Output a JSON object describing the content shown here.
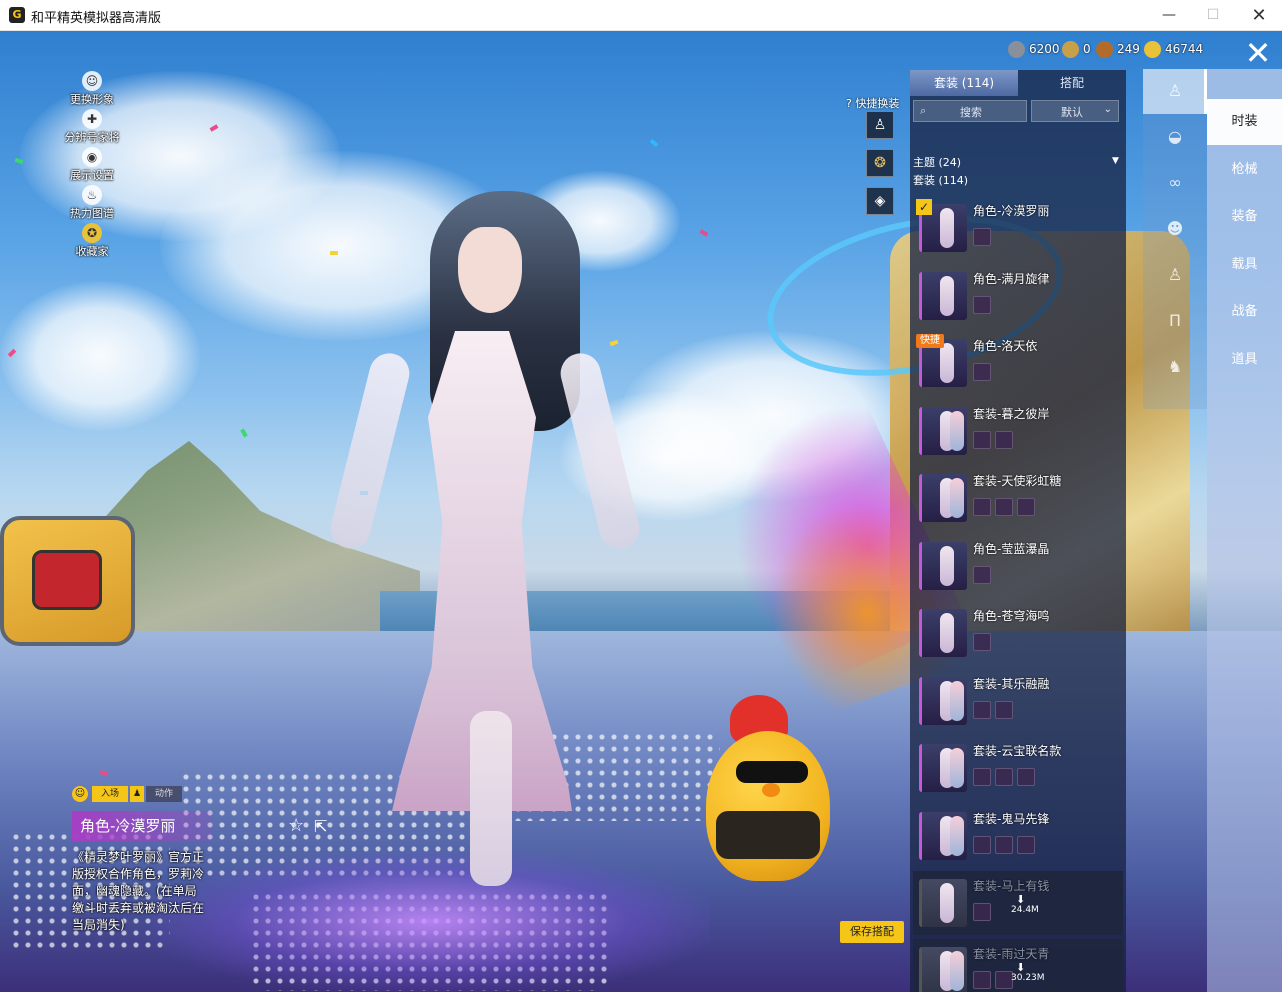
{
  "window": {
    "title": "和平精英模拟器高清版",
    "icon_label": "G",
    "minimize_glyph": "—",
    "maximize_glyph": "☐",
    "close_glyph": "✕"
  },
  "currency": [
    {
      "name": "silver-coin",
      "value": "6200",
      "color": "#8a8f9c"
    },
    {
      "name": "gold-coin",
      "value": "0",
      "color": "#c9a04a"
    },
    {
      "name": "bronze-coin",
      "value": "249",
      "color": "#b36b2a"
    },
    {
      "name": "yellow-coin",
      "value": "46744",
      "color": "#e9c23a"
    }
  ],
  "left_menu": [
    {
      "label": "更换形象",
      "icon": "user-icon",
      "glyph": "☺"
    },
    {
      "label": "分辨号家将",
      "icon": "gamepad-icon",
      "glyph": "✚"
    },
    {
      "label": "展示设置",
      "icon": "eye-icon",
      "glyph": "◉"
    },
    {
      "label": "热力图谱",
      "icon": "flame-icon",
      "glyph": "♨"
    },
    {
      "label": "收藏家",
      "icon": "medal-icon",
      "glyph": "✪"
    }
  ],
  "close_glyph": "✕",
  "categories": [
    {
      "label": "时装",
      "active": true
    },
    {
      "label": "枪械",
      "active": false
    },
    {
      "label": "装备",
      "active": false
    },
    {
      "label": "载具",
      "active": false
    },
    {
      "label": "战备",
      "active": false
    },
    {
      "label": "道具",
      "active": false
    }
  ],
  "slots": [
    {
      "icon": "full-body-icon",
      "glyph": "♙",
      "active": true
    },
    {
      "icon": "hat-icon",
      "glyph": "◒",
      "active": false
    },
    {
      "icon": "glasses-icon",
      "glyph": "∞",
      "active": false
    },
    {
      "icon": "mask-icon",
      "glyph": "☻",
      "active": false
    },
    {
      "icon": "body-icon",
      "glyph": "♙",
      "active": false
    },
    {
      "icon": "pants-icon",
      "glyph": "Π",
      "active": false
    },
    {
      "icon": "shoes-icon",
      "glyph": "♞",
      "active": false
    }
  ],
  "panel": {
    "tabs": [
      {
        "label": "套装 (114)",
        "active": true
      },
      {
        "label": "搭配",
        "active": false
      }
    ],
    "search_placeholder": "搜索",
    "sort_value": "默认",
    "group_theme": "主题 (24)",
    "group_suits": "套装 (114)",
    "items": [
      {
        "name": "角色-冷漠罗丽",
        "subs": 1,
        "selected": true,
        "quick": false,
        "dim": false
      },
      {
        "name": "角色-满月旋律",
        "subs": 1,
        "selected": false,
        "quick": false,
        "dim": false
      },
      {
        "name": "角色-洛天依",
        "subs": 1,
        "selected": false,
        "quick": true,
        "dim": false
      },
      {
        "name": "套装-暮之彼岸",
        "subs": 2,
        "selected": false,
        "quick": false,
        "dim": false
      },
      {
        "name": "套装-天使彩虹糖",
        "subs": 3,
        "selected": false,
        "quick": false,
        "dim": false
      },
      {
        "name": "角色-莹蓝瀑晶",
        "subs": 1,
        "selected": false,
        "quick": false,
        "dim": false
      },
      {
        "name": "角色-苍穹海鸣",
        "subs": 1,
        "selected": false,
        "quick": false,
        "dim": false
      },
      {
        "name": "套装-其乐融融",
        "subs": 2,
        "selected": false,
        "quick": false,
        "dim": false
      },
      {
        "name": "套装-云宝联名款",
        "subs": 3,
        "selected": false,
        "quick": false,
        "dim": false
      },
      {
        "name": "套装-鬼马先锋",
        "subs": 3,
        "selected": false,
        "quick": false,
        "dim": false
      },
      {
        "name": "套装-马上有钱",
        "subs": 1,
        "selected": false,
        "quick": false,
        "dim": true,
        "download": "24.4M"
      },
      {
        "name": "套装-雨过天青",
        "subs": 2,
        "selected": false,
        "quick": false,
        "dim": true,
        "download": "30.23M"
      }
    ],
    "quick_badge": "快捷",
    "check_glyph": "✓",
    "download_glyph": "⬇"
  },
  "quick_change": {
    "label": "快捷换装",
    "help_glyph": "?",
    "boxes": [
      {
        "icon": "outfit-icon",
        "glyph": "♙"
      },
      {
        "icon": "emblem-icon",
        "glyph": "❂"
      },
      {
        "icon": "diamond-icon",
        "glyph": "◈"
      }
    ]
  },
  "save_button": "保存搭配",
  "info": {
    "mode_enter": "入场",
    "mode_action": "动作",
    "face_glyph": "☺",
    "action_glyph": "♟",
    "name": "角色-冷漠罗丽",
    "description": "《精灵梦叶罗丽》官方正版授权合作角色，罗莉冷面，幽魂隐藏。(在单局缴斗时丢弃或被淘汰后在当局消失)",
    "fav_glyph": "☆",
    "share_glyph": "⇱"
  }
}
